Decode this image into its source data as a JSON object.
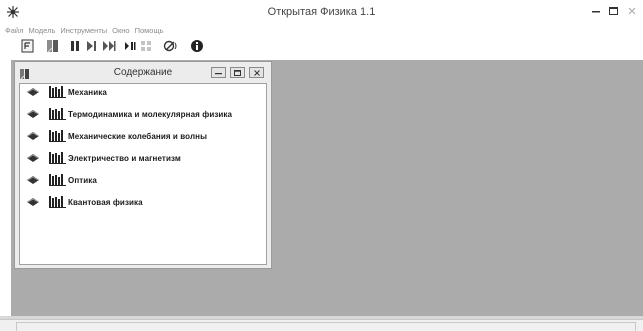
{
  "app": {
    "title": "Открытая Физика 1.1"
  },
  "menu": [
    "Файл",
    "Модель",
    "Инструменты",
    "Окно",
    "Помощь"
  ],
  "toolbar": {
    "buttons": [
      "contents-icon",
      "bookmark-icon",
      "pause-icon",
      "step-icon",
      "play-icon",
      "step-forward-icon",
      "grid-icon",
      "audio-icon",
      "info-icon"
    ]
  },
  "contents_window": {
    "title": "Содержание",
    "items": [
      {
        "label": "Механика"
      },
      {
        "label": "Термодинамика и молекулярная физика"
      },
      {
        "label": "Механические колебания и волны"
      },
      {
        "label": "Электричество и магнетизм"
      },
      {
        "label": "Оптика"
      },
      {
        "label": "Квантовая физика"
      }
    ]
  },
  "colors": {
    "workspace": "#ababab",
    "window_bg": "#ededed",
    "text": "#1a1a1a",
    "menu_text": "#8c8c8c"
  }
}
